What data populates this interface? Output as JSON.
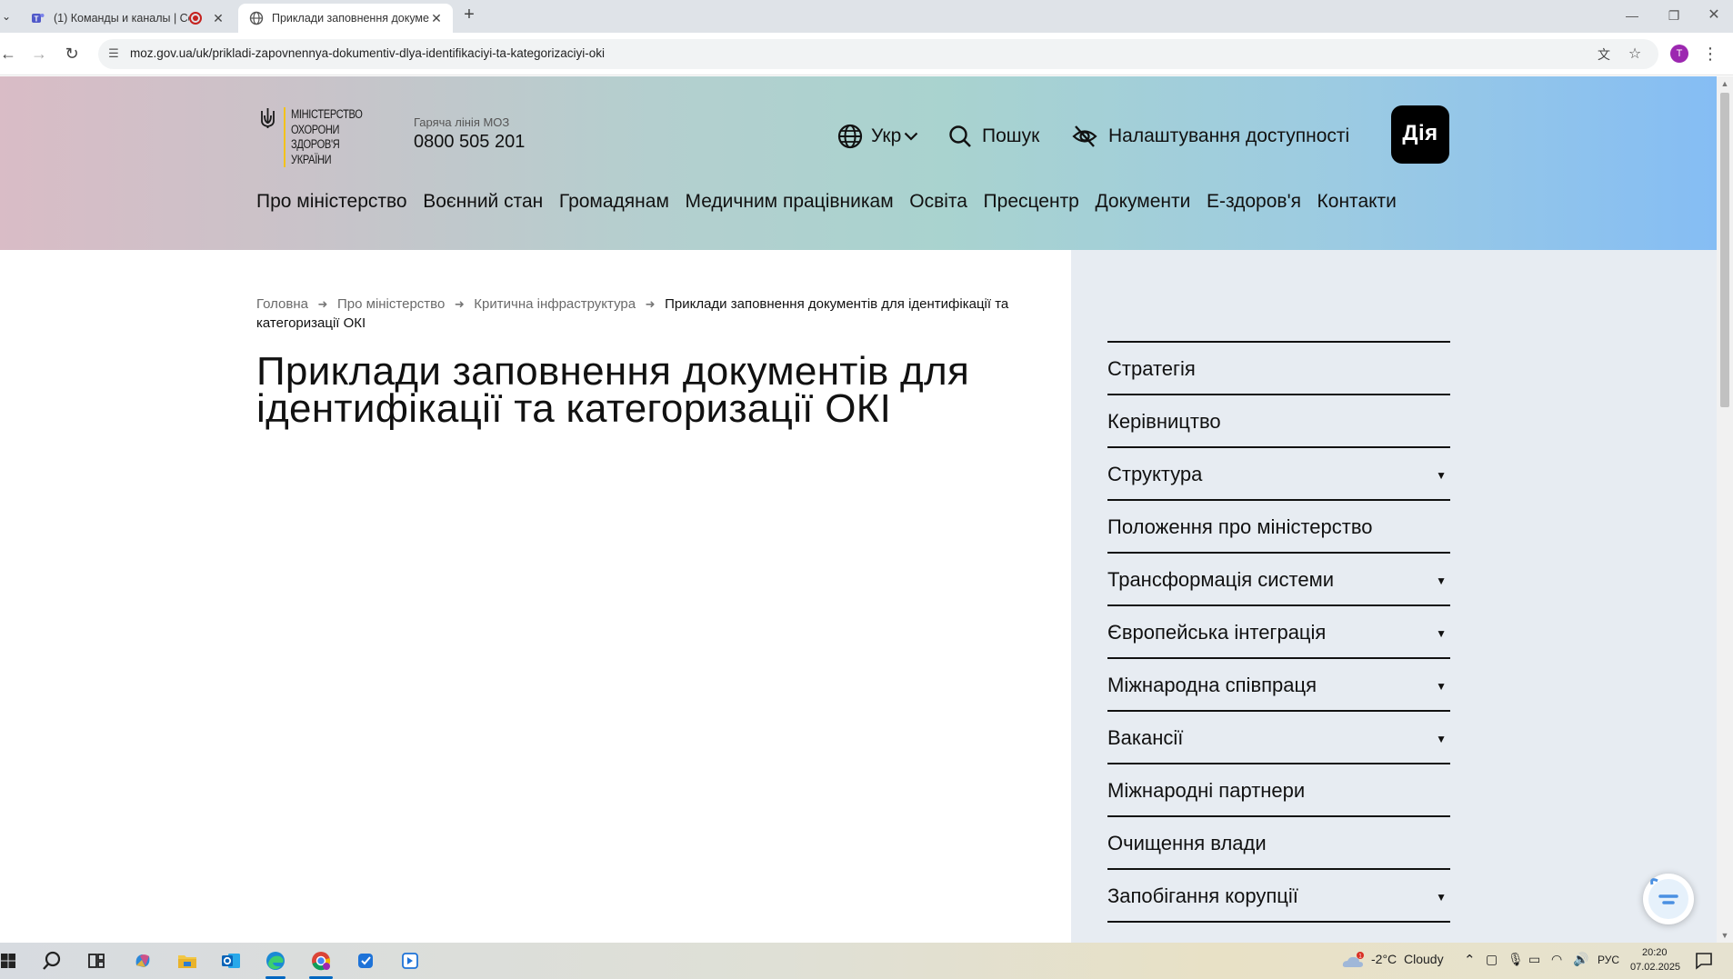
{
  "browser": {
    "tabs": [
      {
        "title": "(1) Команды и каналы | Co",
        "active": false,
        "icon": "teams-icon"
      },
      {
        "title": "Приклади заповнення докуме",
        "active": true,
        "icon": "globe-icon"
      }
    ],
    "url": "moz.gov.ua/uk/prikladi-zapovnennya-dokumentiv-dlya-identifikaciyi-ta-kategorizaciyi-oki",
    "profile_initial": "T"
  },
  "header": {
    "logo_lines": [
      "МІНІСТЕРСТВО",
      "ОХОРОНИ",
      "ЗДОРОВ'Я",
      "УКРАЇНИ"
    ],
    "hotline_label": "Гаряча лінія МОЗ",
    "hotline_number": "0800 505 201",
    "language": "Укр",
    "search_label": "Пошук",
    "accessibility_label": "Налаштування доступності",
    "diia_label": "Дія",
    "nav": [
      "Про міністерство",
      "Воєнний стан",
      "Громадянам",
      "Медичним працівникам",
      "Освіта",
      "Пресцентр",
      "Документи",
      "Е-здоров'я",
      "Контакти"
    ]
  },
  "breadcrumb": {
    "items": [
      "Головна",
      "Про міністерство",
      "Критична інфраструктура"
    ],
    "current": "Приклади заповнення документів для ідентифікації та категоризації ОКІ"
  },
  "page_title": "Приклади заповнення документів для ідентифікації та категоризації ОКІ",
  "sidebar": {
    "items": [
      {
        "label": "Стратегія",
        "expandable": false
      },
      {
        "label": "Керівництво",
        "expandable": false
      },
      {
        "label": "Структура",
        "expandable": true
      },
      {
        "label": "Положення про міністерство",
        "expandable": false
      },
      {
        "label": "Трансформація системи",
        "expandable": true
      },
      {
        "label": "Європейська інтеграція",
        "expandable": true
      },
      {
        "label": "Міжнародна співпраця",
        "expandable": true
      },
      {
        "label": "Вакансії",
        "expandable": true
      },
      {
        "label": "Міжнародні партнери",
        "expandable": false
      },
      {
        "label": "Очищення влади",
        "expandable": false
      },
      {
        "label": "Запобігання корупції",
        "expandable": true
      }
    ]
  },
  "taskbar": {
    "weather_temp": "-2°C",
    "weather_text": "Cloudy",
    "language": "РУС",
    "time": "20:20",
    "date": "07.02.2025"
  },
  "colors": {
    "accent_yellow": "#f3c21a",
    "diia_bg": "#000000",
    "sidebar_bg": "#e7ecf2"
  }
}
